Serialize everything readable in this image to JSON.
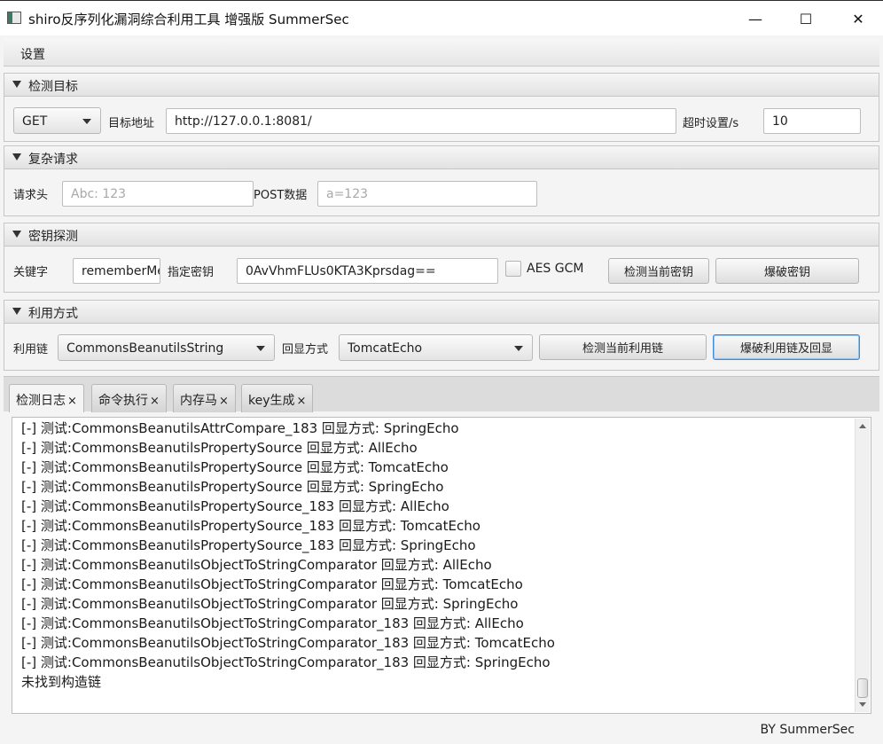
{
  "window": {
    "title": "shiro反序列化漏洞综合利用工具 增强版 SummerSec",
    "minimize_glyph": "—",
    "maximize_glyph": "☐",
    "close_glyph": "✕"
  },
  "menu": {
    "settings": "设置"
  },
  "target": {
    "header": "检测目标",
    "method": "GET",
    "url_label": "目标地址",
    "url_value": "http://127.0.0.1:8081/",
    "timeout_label": "超时设置/s",
    "timeout_value": "10"
  },
  "complex": {
    "header": "复杂请求",
    "headers_label": "请求头",
    "headers_placeholder": "Abc: 123",
    "post_label": "POST数据",
    "post_placeholder": "a=123"
  },
  "key": {
    "header": "密钥探测",
    "keyword_label": "关键字",
    "keyword_value": "rememberMe",
    "key_label": "指定密钥",
    "key_value": "0AvVhmFLUs0KTA3Kprsdag==",
    "aes_gcm_label": "AES GCM",
    "check_key_button": "检测当前密钥",
    "brute_key_button": "爆破密钥"
  },
  "exploit": {
    "header": "利用方式",
    "chain_label": "利用链",
    "chain_value": "CommonsBeanutilsString",
    "echo_label": "回显方式",
    "echo_value": "TomcatEcho",
    "check_chain_button": "检测当前利用链",
    "brute_chain_button": "爆破利用链及回显"
  },
  "tabs": [
    {
      "label": "检测日志"
    },
    {
      "label": "命令执行"
    },
    {
      "label": "内存马"
    },
    {
      "label": "key生成"
    }
  ],
  "tab_close_glyph": "×",
  "log": [
    "[-] 测试:CommonsBeanutilsAttrCompare_183  回显方式: SpringEcho",
    "[-] 测试:CommonsBeanutilsPropertySource  回显方式: AllEcho",
    "[-] 测试:CommonsBeanutilsPropertySource  回显方式: TomcatEcho",
    "[-] 测试:CommonsBeanutilsPropertySource  回显方式: SpringEcho",
    "[-] 测试:CommonsBeanutilsPropertySource_183  回显方式: AllEcho",
    "[-] 测试:CommonsBeanutilsPropertySource_183  回显方式: TomcatEcho",
    "[-] 测试:CommonsBeanutilsPropertySource_183  回显方式: SpringEcho",
    "[-] 测试:CommonsBeanutilsObjectToStringComparator  回显方式: AllEcho",
    "[-] 测试:CommonsBeanutilsObjectToStringComparator  回显方式: TomcatEcho",
    "[-] 测试:CommonsBeanutilsObjectToStringComparator  回显方式: SpringEcho",
    "[-] 测试:CommonsBeanutilsObjectToStringComparator_183  回显方式: AllEcho",
    "[-] 测试:CommonsBeanutilsObjectToStringComparator_183  回显方式: TomcatEcho",
    "[-] 测试:CommonsBeanutilsObjectToStringComparator_183  回显方式: SpringEcho",
    "未找到构造链"
  ],
  "footer": "BY   SummerSec"
}
